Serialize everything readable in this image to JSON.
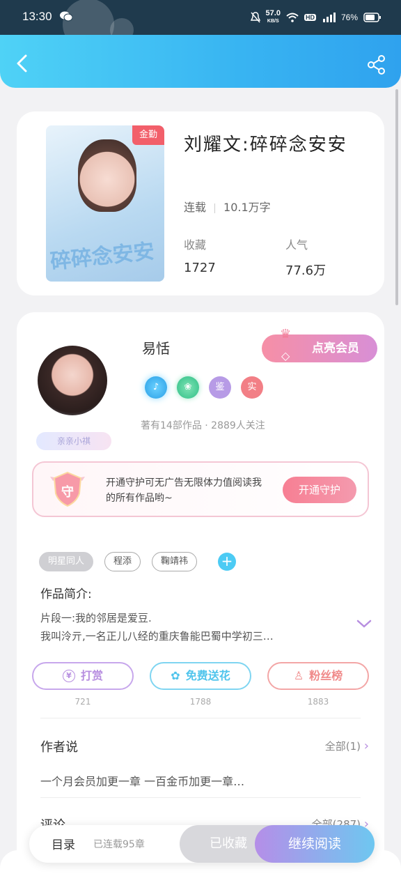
{
  "status_bar": {
    "time": "13:30",
    "net_speed": "57.0",
    "net_unit": "KB/S",
    "hd": "HD",
    "battery": "76%"
  },
  "book": {
    "cover_title": "碎碎念安安",
    "badge": "金勤",
    "title": "刘耀文:碎碎念安安",
    "status": "连载",
    "word_count": "10.1万字",
    "collect_label": "收藏",
    "collect_value": "1727",
    "popularity_label": "人气",
    "popularity_value": "77.6万"
  },
  "author": {
    "name": "易恬",
    "tag": "亲亲小祺",
    "vip_label": "点亮会员",
    "badges": [
      "music-badge",
      "shell-badge",
      "鉴",
      "实"
    ],
    "stats": "著有14部作品 · 2889人关注"
  },
  "guard": {
    "text": "开通守护可无广告无限体力值阅读我的所有作品哟~",
    "button": "开通守护",
    "shield_text": "守"
  },
  "tags": [
    "明星同人",
    "程添",
    "鞠靖祎"
  ],
  "intro": {
    "label": "作品简介:",
    "line1": "片段一:我的邻居是爱豆.",
    "line2": "我叫泠亓,一名正儿八经的重庆鲁能巴蜀中学初三…"
  },
  "actions": [
    {
      "label": "打赏",
      "count": "721",
      "color": "#b78ee0"
    },
    {
      "label": "免费送花",
      "count": "1788",
      "color": "#4fc4ec"
    },
    {
      "label": "粉丝榜",
      "count": "1883",
      "color": "#f08a8a"
    }
  ],
  "author_says": {
    "title": "作者说",
    "more": "全部(1)",
    "text": "一个月会员加更一章 一百金币加更一章…"
  },
  "comments": {
    "title": "评论",
    "more": "全部(287)"
  },
  "bottom": {
    "toc": "目录",
    "toc_info": "已连载95章",
    "collected": "已收藏",
    "read": "继续阅读"
  },
  "colors": {
    "header_start": "#4fd2f6",
    "header_end": "#2fa2ee",
    "accent_pink": "#f77f93"
  }
}
